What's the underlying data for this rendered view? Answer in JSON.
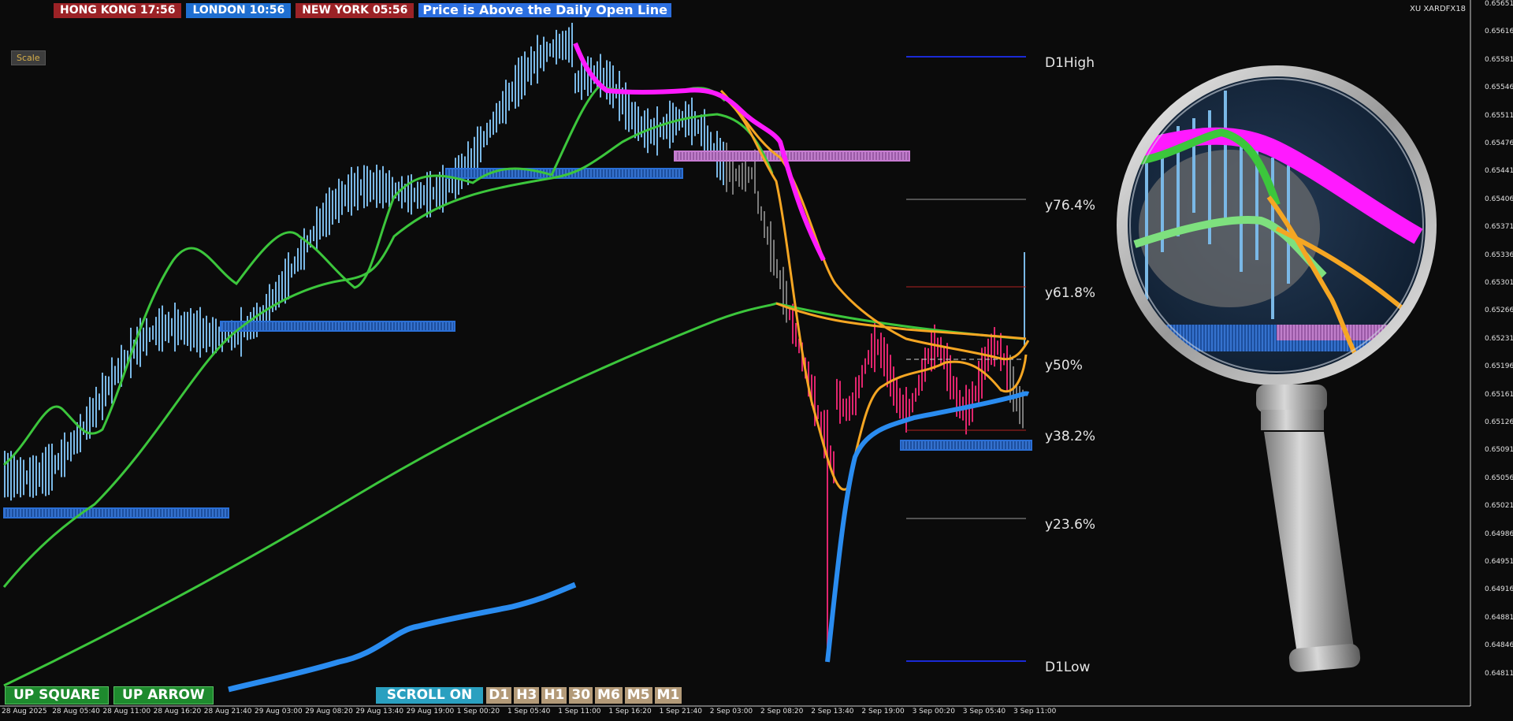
{
  "sessions": {
    "hong_kong": "HONG KONG  17:56",
    "london": "LONDON  10:56",
    "new_york": "NEW YORK  05:56",
    "status": "Price is Above the Daily Open Line"
  },
  "scale_button": "Scale",
  "symbol": "XU XARDFX18",
  "levels": {
    "d1_high": "D1High",
    "fib_764": "y76.4%",
    "fib_618": "y61.8%",
    "fib_50": "y50%",
    "fib_382": "y38.2%",
    "fib_236": "y23.6%",
    "d1_low": "D1Low"
  },
  "bottom_bar": {
    "up_square": "UP SQUARE",
    "up_arrow": "UP ARROW",
    "scroll": "SCROLL ON",
    "timeframes": [
      "D1",
      "H3",
      "H1",
      "30",
      "M6",
      "M5",
      "M1"
    ]
  },
  "price_axis": [
    "0.65651",
    "0.65616",
    "0.65581",
    "0.65546",
    "0.65511",
    "0.65476",
    "0.65441",
    "0.65406",
    "0.65371",
    "0.65336",
    "0.65301",
    "0.65266",
    "0.65231",
    "0.65196",
    "0.65161",
    "0.65126",
    "0.65091",
    "0.65056",
    "0.65021",
    "0.64986",
    "0.64951",
    "0.64916",
    "0.64881",
    "0.64846",
    "0.64811"
  ],
  "time_axis": [
    "28 Aug 2025",
    "28 Aug 05:40",
    "28 Aug 11:00",
    "28 Aug 16:20",
    "28 Aug 21:40",
    "29 Aug 03:00",
    "29 Aug 08:20",
    "29 Aug 13:40",
    "29 Aug 19:00",
    "1 Sep 00:20",
    "1 Sep 05:40",
    "1 Sep 11:00",
    "1 Sep 16:20",
    "1 Sep 21:40",
    "2 Sep 03:00",
    "2 Sep 08:20",
    "2 Sep 13:40",
    "2 Sep 19:00",
    "3 Sep 00:20",
    "3 Sep 05:40",
    "3 Sep 11:00"
  ],
  "colors": {
    "background": "#0b0b0b",
    "candle_up": "#7ab8e6",
    "candle_bear": "#e0256d",
    "ma_green": "#3cc63c",
    "ma_orange": "#f5a623",
    "ma_magenta": "#ff1aff",
    "ma_blue": "#2a8cf0",
    "zone_blue": "#2a6fd6",
    "zone_pink": "#c77bd1",
    "d1_line": "#1a2ad6"
  }
}
